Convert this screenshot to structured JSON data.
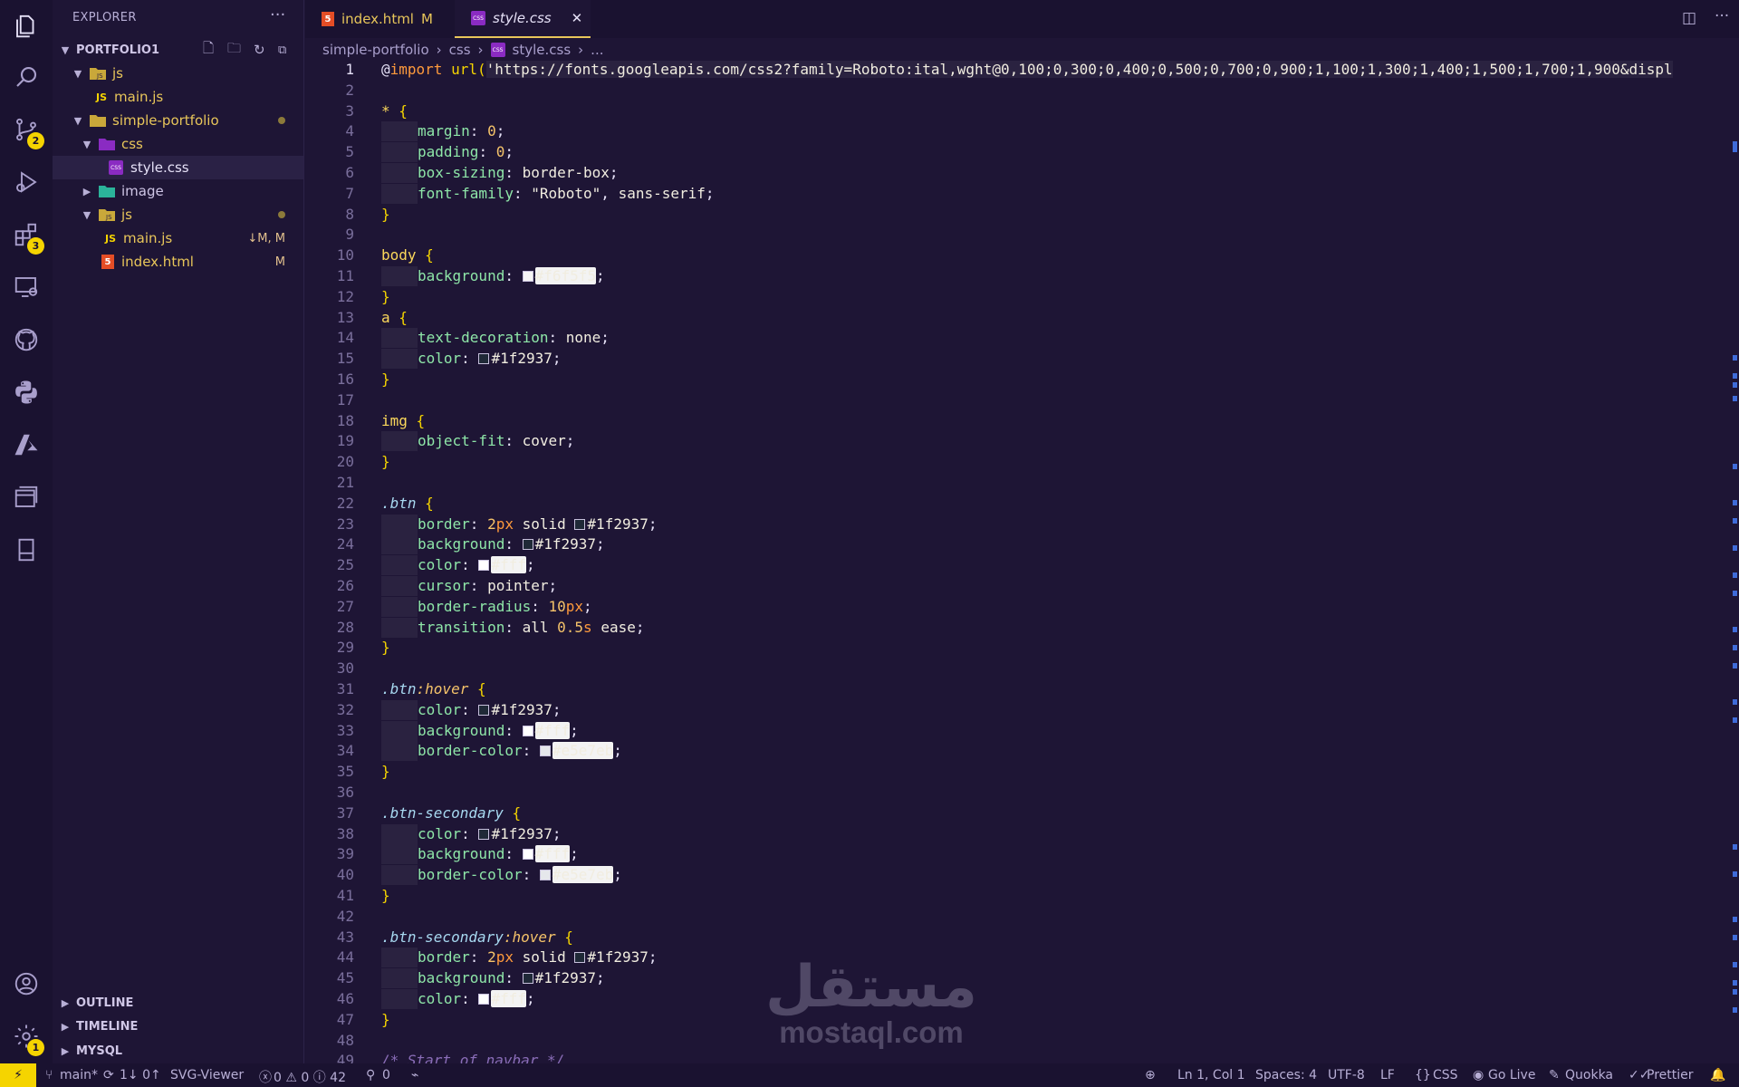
{
  "activity_bar": {
    "items": [
      {
        "icon": "files-icon"
      },
      {
        "icon": "search-icon"
      },
      {
        "icon": "source-control-icon",
        "badge": "2"
      },
      {
        "icon": "run-debug-icon"
      },
      {
        "icon": "extensions-icon",
        "badge": "3"
      },
      {
        "icon": "remote-explorer-icon"
      },
      {
        "icon": "github-icon"
      },
      {
        "icon": "python-icon"
      },
      {
        "icon": "azure-icon"
      },
      {
        "icon": "browser-icon"
      },
      {
        "icon": "device-icon"
      }
    ],
    "account_icon": "account-icon",
    "settings_badge": "1"
  },
  "sidebar": {
    "title": "EXPLORER",
    "more": "···",
    "root": "PORTFOLIO1",
    "tree": [
      {
        "label": "js",
        "type": "folder"
      },
      {
        "label": "main.js",
        "type": "js"
      },
      {
        "label": "simple-portfolio",
        "type": "folder"
      },
      {
        "label": "css",
        "type": "css-folder"
      },
      {
        "label": "style.css",
        "type": "css"
      },
      {
        "label": "image",
        "type": "image-folder"
      },
      {
        "label": "js",
        "type": "folder"
      },
      {
        "label": "main.js",
        "type": "js",
        "status": "↓M, M"
      },
      {
        "label": "index.html",
        "type": "html",
        "status": "M"
      }
    ],
    "panels": [
      "OUTLINE",
      "TIMELINE",
      "MYSQL"
    ]
  },
  "tabs": [
    {
      "label": "index.html",
      "status": "M"
    },
    {
      "label": "style.css",
      "close": "✕"
    }
  ],
  "breadcrumb": [
    "simple-portfolio",
    "css",
    "style.css",
    "..."
  ],
  "editor": {
    "line_numbers": [
      "1",
      "2",
      "3",
      "4",
      "5",
      "6",
      "7",
      "8",
      "9",
      "10",
      "11",
      "12",
      "13",
      "14",
      "15",
      "16",
      "17",
      "18",
      "19",
      "20",
      "21",
      "22",
      "23",
      "24",
      "25",
      "26",
      "27",
      "28",
      "29",
      "30",
      "31",
      "32",
      "33",
      "34",
      "35",
      "36",
      "37",
      "38",
      "39",
      "40",
      "41",
      "42",
      "43",
      "44",
      "45",
      "46",
      "47",
      "48",
      "49"
    ],
    "import_url": "https://fonts.googleapis.com/css2?family=Roboto:ital,wght@0,100;0,300;0,400;0,500;0,700;0,900;1,100;1,300;1,400;1,500;1,700;1,900&displ",
    "comment": "/* Start of navbar */"
  },
  "statusbar": {
    "branch": "main*",
    "sync": "1↓ 0↑",
    "svg_viewer": "SVG-Viewer",
    "problems": "0 ⚠ 0 ⓘ 42",
    "ports": "0",
    "position": "Ln 1, Col 1",
    "spaces": "Spaces: 4",
    "encoding": "UTF-8",
    "eol": "LF",
    "language": "CSS",
    "golive": "Go Live",
    "quokka": "Quokka",
    "prettier": "Prettier"
  },
  "watermark": {
    "arabic": "مستقل",
    "latin": "mostaql.com"
  },
  "colors": {
    "accent": "#f5d400",
    "background": "#1e1535"
  }
}
